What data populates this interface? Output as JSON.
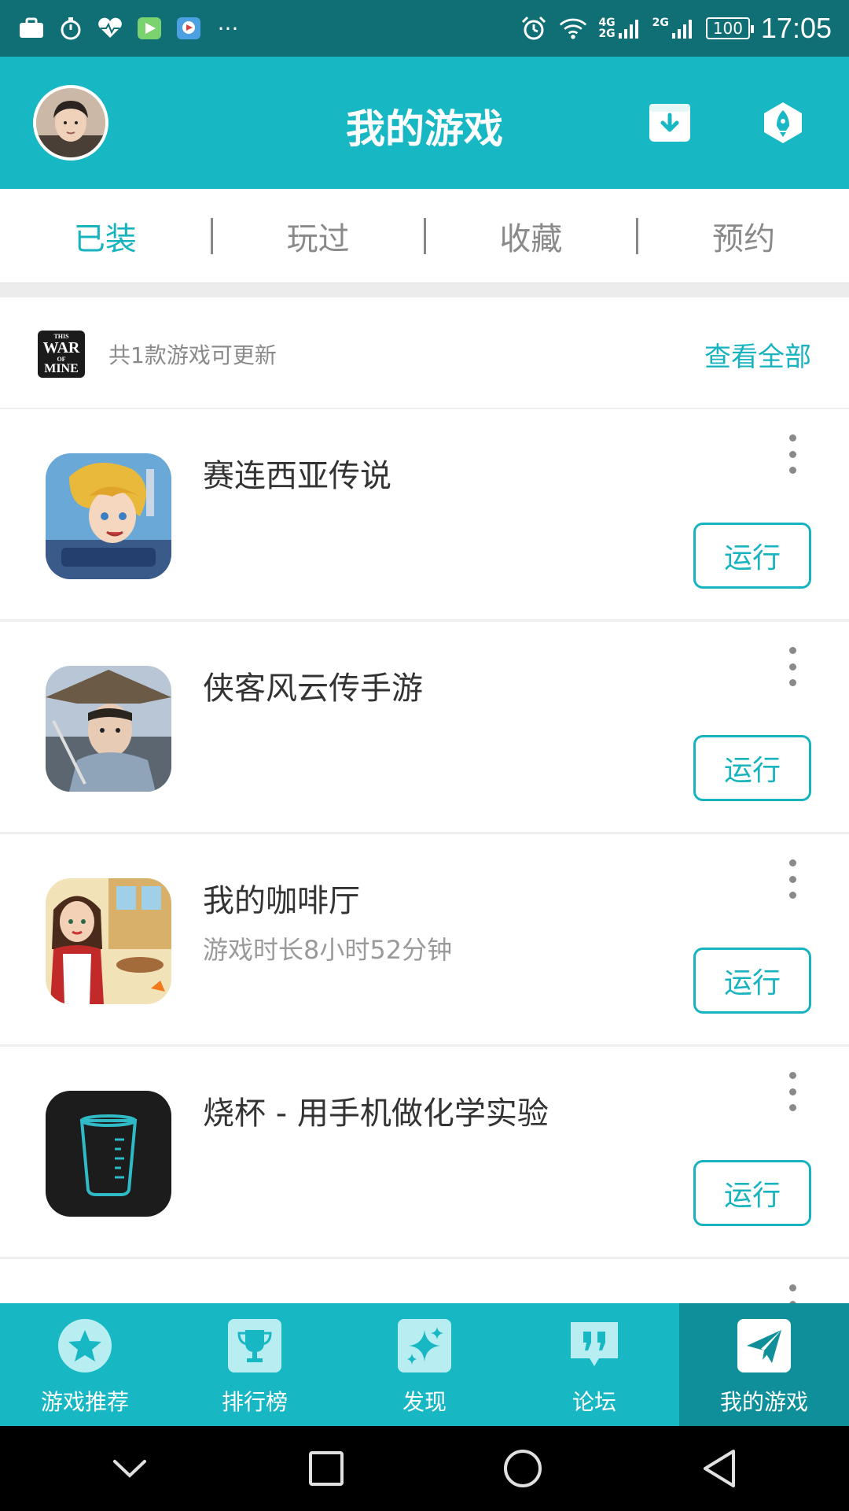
{
  "status_bar": {
    "network_4g": "4G",
    "network_2g_a": "2G",
    "network_2g_b": "2G",
    "battery": "100",
    "time": "17:05"
  },
  "header": {
    "title": "我的游戏"
  },
  "tabs": [
    {
      "label": "已装",
      "active": true
    },
    {
      "label": "玩过",
      "active": false
    },
    {
      "label": "收藏",
      "active": false
    },
    {
      "label": "预约",
      "active": false
    }
  ],
  "update_banner": {
    "icon_text_top": "THIS",
    "icon_text_mid": "WAR",
    "icon_text_of": "OF",
    "icon_text_bottom": "MINE",
    "text": "共1款游戏可更新",
    "view_all": "查看全部"
  },
  "games": [
    {
      "name": "赛连西亚传说",
      "playtime": "",
      "run": "运行",
      "icon": "anime-hero-icon"
    },
    {
      "name": "侠客风云传手游",
      "playtime": "",
      "run": "运行",
      "icon": "swordsman-icon"
    },
    {
      "name": "我的咖啡厅",
      "playtime": "游戏时长8小时52分钟",
      "run": "运行",
      "icon": "cafe-icon"
    },
    {
      "name": "烧杯 - 用手机做化学实验",
      "playtime": "",
      "run": "运行",
      "icon": "beaker-icon"
    }
  ],
  "bottom_nav": [
    {
      "label": "游戏推荐",
      "icon": "star-icon",
      "active": false
    },
    {
      "label": "排行榜",
      "icon": "trophy-icon",
      "active": false
    },
    {
      "label": "发现",
      "icon": "sparkle-icon",
      "active": false
    },
    {
      "label": "论坛",
      "icon": "quote-icon",
      "active": false
    },
    {
      "label": "我的游戏",
      "icon": "paper-plane-icon",
      "active": true
    }
  ],
  "colors": {
    "accent": "#17b8c4",
    "status_bar": "#0f6f74",
    "nav_active": "#0f8f99"
  }
}
